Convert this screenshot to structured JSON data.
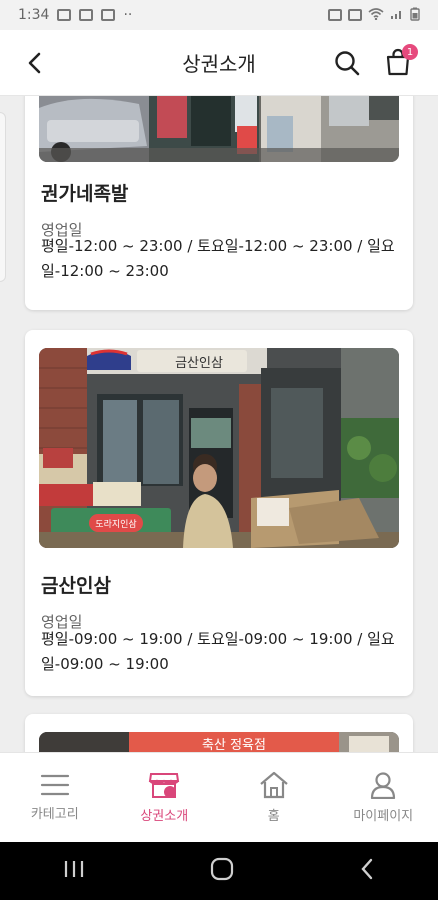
{
  "status_bar": {
    "time": "1:34",
    "dots": "··"
  },
  "header": {
    "title": "상권소개",
    "cart_count": "1"
  },
  "cards": [
    {
      "title": "권가네족발",
      "hours_label": "영업일",
      "hours": "평일-12:00 ~ 23:00 / 토요일-12:00 ~ 23:00 / 일요일-12:00 ~ 23:00"
    },
    {
      "title": "금산인삼",
      "hours_label": "영업일",
      "hours": "평일-09:00 ~ 19:00 / 토요일-09:00 ~ 19:00 / 일요일-09:00 ~ 19:00",
      "sign_text": "금산인삼",
      "sign2_text": "도라지인삼"
    },
    {
      "sign_text": "축산 정육점"
    }
  ],
  "bottom_nav": [
    {
      "label": "카테고리",
      "icon": "menu-icon"
    },
    {
      "label": "상권소개",
      "icon": "store-icon",
      "active": true
    },
    {
      "label": "홈",
      "icon": "home-icon"
    },
    {
      "label": "마이페이지",
      "icon": "person-icon"
    }
  ],
  "colors": {
    "accent": "#d9467a",
    "badge": "#e64a7d"
  }
}
